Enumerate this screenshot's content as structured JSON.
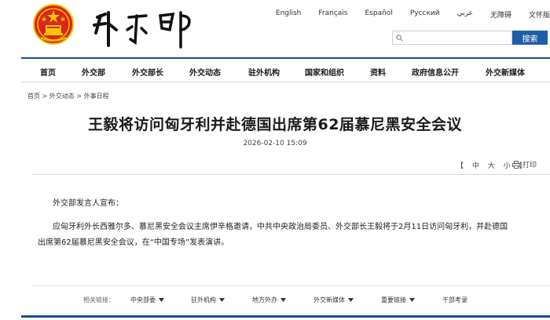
{
  "header": {
    "languages": [
      "English",
      "Français",
      "Español",
      "Русский",
      "عربي",
      "无障碍",
      "文怀版"
    ],
    "search_button": "搜索",
    "search_placeholder": ""
  },
  "nav": {
    "items": [
      "首页",
      "外交部",
      "外交部长",
      "外交动态",
      "驻外机构",
      "国家和组织",
      "资料",
      "政府信息公开",
      "外交新媒体"
    ]
  },
  "breadcrumb": "首页 > 外交动态 > 外事日程",
  "article": {
    "title": "王毅将访问匈牙利并赴德国出席第62届慕尼黑安全会议",
    "date": "2026-02-10 15:09",
    "font_size": {
      "open": "【",
      "large": "中",
      "medium": "大",
      "small": "小",
      "close": "】"
    },
    "print_label": "打印",
    "paragraphs": [
      "外交部发言人宣布：",
      "应匈牙利外长西雅尔多、慕尼黑安全会议主席伊辛格邀请，中共中央政治局委员、外交部长王毅将于2月11日访问匈牙利，并赴德国出席第62届慕尼黑安全会议，在“中国专场”发表演讲。"
    ]
  },
  "related_links": {
    "label": "相关链接：",
    "items": [
      "中央部委",
      "驻外机构",
      "地方外办",
      "外交新媒体",
      "重要链接",
      "干部考录"
    ]
  },
  "colors": {
    "primary": "#1c4f8f",
    "button": "#1d5ea8",
    "emblem_red": "#d9261c",
    "emblem_gold": "#f4c400"
  }
}
